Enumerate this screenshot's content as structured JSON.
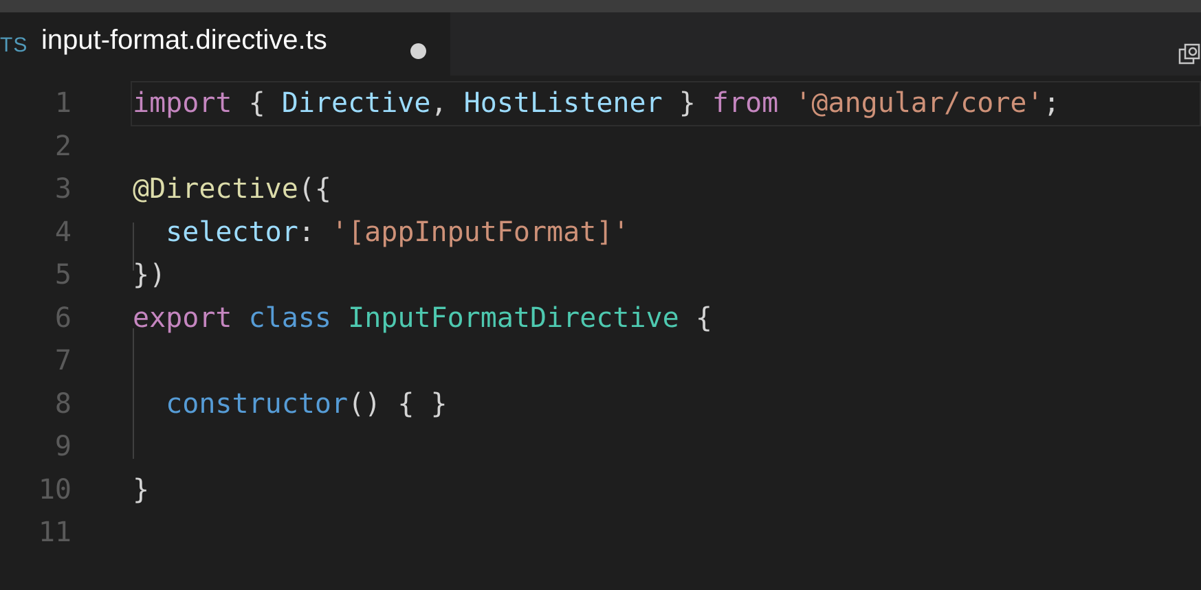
{
  "tab": {
    "language_badge": "TS",
    "filename": "input-format.directive.ts",
    "dirty": true
  },
  "icons": {
    "split_editor": "split-editor-icon",
    "unsaved": "unsaved-dot-icon"
  },
  "colors": {
    "keyword_control": "#c586c0",
    "keyword_storage": "#569cd6",
    "identifier": "#9cdcfe",
    "type": "#4ec9b0",
    "string": "#ce9178",
    "function": "#dcdcaa",
    "line_number": "#5a5a5a",
    "editor_background": "#1e1e1e"
  },
  "editor": {
    "lines": [
      {
        "number": "1",
        "tokens": [
          {
            "text": "import",
            "kind": "kw-import"
          },
          {
            "text": " { ",
            "kind": "punc"
          },
          {
            "text": "Directive",
            "kind": "ident"
          },
          {
            "text": ", ",
            "kind": "punc"
          },
          {
            "text": "HostListener",
            "kind": "ident"
          },
          {
            "text": " } ",
            "kind": "punc"
          },
          {
            "text": "from",
            "kind": "kw-import"
          },
          {
            "text": " ",
            "kind": "punc"
          },
          {
            "text": "'@angular/core'",
            "kind": "str"
          },
          {
            "text": ";",
            "kind": "punc"
          }
        ]
      },
      {
        "number": "2",
        "tokens": []
      },
      {
        "number": "3",
        "tokens": [
          {
            "text": "@",
            "kind": "fn"
          },
          {
            "text": "Directive",
            "kind": "fn"
          },
          {
            "text": "({",
            "kind": "punc"
          }
        ]
      },
      {
        "number": "4",
        "tokens": [
          {
            "text": "  ",
            "kind": "punc"
          },
          {
            "text": "selector",
            "kind": "ident"
          },
          {
            "text": ": ",
            "kind": "punc"
          },
          {
            "text": "'[appInputFormat]'",
            "kind": "str"
          }
        ]
      },
      {
        "number": "5",
        "tokens": [
          {
            "text": "})",
            "kind": "punc"
          }
        ]
      },
      {
        "number": "6",
        "tokens": [
          {
            "text": "export",
            "kind": "kw-import"
          },
          {
            "text": " ",
            "kind": "punc"
          },
          {
            "text": "class",
            "kind": "kw-storage"
          },
          {
            "text": " ",
            "kind": "punc"
          },
          {
            "text": "InputFormatDirective",
            "kind": "type"
          },
          {
            "text": " {",
            "kind": "punc"
          }
        ]
      },
      {
        "number": "7",
        "tokens": []
      },
      {
        "number": "8",
        "tokens": [
          {
            "text": "  ",
            "kind": "punc"
          },
          {
            "text": "constructor",
            "kind": "ctor"
          },
          {
            "text": "() { }",
            "kind": "punc"
          }
        ]
      },
      {
        "number": "9",
        "tokens": []
      },
      {
        "number": "10",
        "tokens": [
          {
            "text": "}",
            "kind": "punc"
          }
        ]
      },
      {
        "number": "11",
        "tokens": []
      }
    ]
  }
}
